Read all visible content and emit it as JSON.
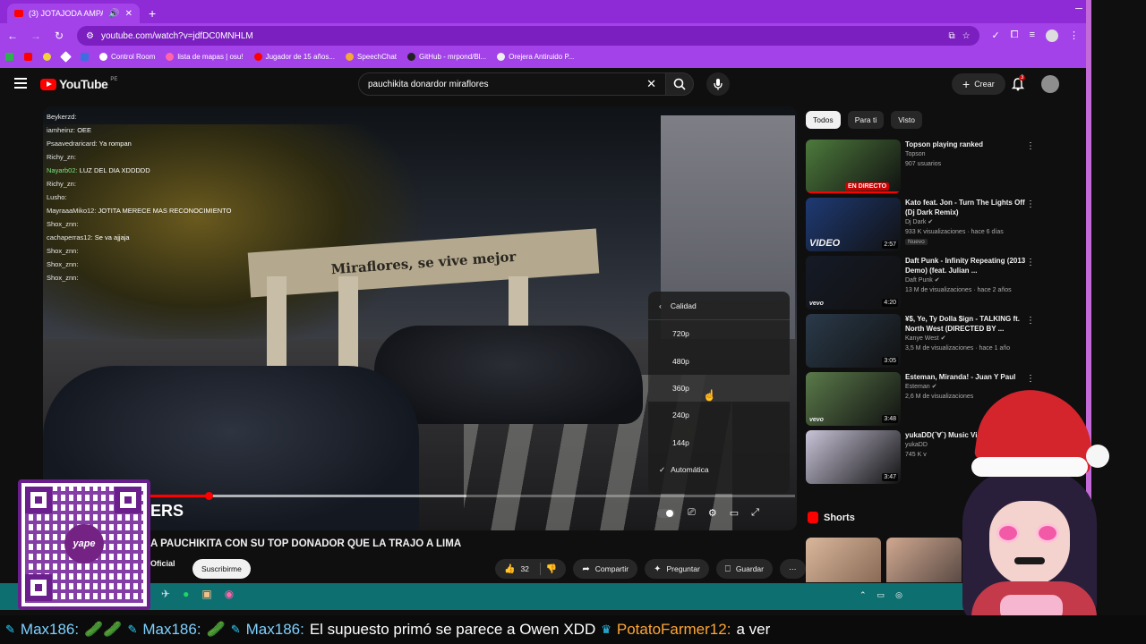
{
  "browser": {
    "tab_title": "(3) JOTAJODA AMPAYA A P...",
    "url": "youtube.com/watch?v=jdfDC0MNHLM",
    "bookmarks": [
      {
        "label": "Control Room",
        "color": "#ffffff"
      },
      {
        "label": "lista de mapas | osu!",
        "color": "#ff66aa"
      },
      {
        "label": "Jugador de 15 años...",
        "color": "#ff0000"
      },
      {
        "label": "SpeechChat",
        "color": "#f4a83a"
      },
      {
        "label": "GitHub - mrpond/Bl...",
        "color": "#222222"
      },
      {
        "label": "Orejera Antiruido P...",
        "color": "#eeeeee"
      }
    ]
  },
  "youtube": {
    "logo": "YouTube",
    "country": "PE",
    "search_value": "pauchikita donardor miraflores",
    "create_label": "Crear",
    "notif_count": "3"
  },
  "player": {
    "chat": [
      {
        "user": "",
        "msg": ""
      },
      {
        "user": "",
        "msg": ""
      },
      {
        "user": "",
        "msg": ""
      },
      {
        "user": "Beykerzd:",
        "msg": ""
      },
      {
        "user": "iamheinz:",
        "msg": "OEE"
      },
      {
        "user": "Psaavedraricard:",
        "msg": "Ya rompan"
      },
      {
        "user": "Richy_zn:",
        "msg": ""
      },
      {
        "user": "Nayarb02:",
        "msg": "LUZ DEL DIA XDDDDD",
        "green": true
      },
      {
        "user": "Richy_zn:",
        "msg": ""
      },
      {
        "user": "Lusho:",
        "msg": ""
      },
      {
        "user": "MayraaaMiko12:",
        "msg": "JOTITA MERECE MAS RECONOCIMIENTO"
      },
      {
        "user": "Shox_znn:",
        "msg": ""
      },
      {
        "user": "cachaperras12:",
        "msg": "Se va ajjaja"
      },
      {
        "user": "Shox_znn:",
        "msg": ""
      },
      {
        "user": "Shox_znn:",
        "msg": ""
      },
      {
        "user": "Shox_znn:",
        "msg": ""
      }
    ],
    "arch_text": "Miraflores, se vive mejor",
    "overlay_brand": "ERS",
    "quality_menu": {
      "header": "Calidad",
      "options": [
        "720p",
        "480p",
        "360p",
        "240p",
        "144p"
      ],
      "selected": "Automática",
      "hovered": "360p"
    },
    "progress_played": 0.09,
    "progress_loaded": 0.49
  },
  "video": {
    "title": "A PAUCHIKITA CON SU TOP DONADOR QUE LA TRAJO A LIMA",
    "channel": "Oficial",
    "subscribe_label": "Suscribirme",
    "likes": "32",
    "share_label": "Compartir",
    "ask_label": "Preguntar",
    "save_label": "Guardar"
  },
  "sidebar": {
    "chips": [
      "Todos",
      "Para ti",
      "Visto"
    ],
    "recommendations": [
      {
        "title": "Topson playing ranked",
        "channel": "Topson",
        "meta": "907 usuarios",
        "badge": "EN DIRECTO",
        "duration": "",
        "thumb": "#4d7a3c",
        "verified": false
      },
      {
        "title": "Kato feat. Jon - Turn The Lights Off (Dj Dark Remix)",
        "channel": "Dj Dark",
        "meta": "933 K visualizaciones · hace 6 días",
        "badge": "",
        "duration": "2:57",
        "thumb": "#1e3a74",
        "new": "Nuevo",
        "verified": true,
        "watermark": "VIDEO"
      },
      {
        "title": "Daft Punk - Infinity Repeating (2013 Demo) (feat. Julian ...",
        "channel": "Daft Punk",
        "meta": "13 M de visualizaciones · hace 2 años",
        "badge": "",
        "duration": "4:20",
        "thumb": "#151a26",
        "verified": true,
        "watermark": "vevo"
      },
      {
        "title": "¥$, Ye, Ty Dolla $ign - TALKING ft. North West  (DIRECTED BY ...",
        "channel": "Kanye West",
        "meta": "3,5 M de visualizaciones · hace 1 año",
        "badge": "",
        "duration": "3:05",
        "thumb": "#2a3a4a",
        "verified": true
      },
      {
        "title": "Esteman, Miranda! - Juan Y Paul",
        "channel": "Esteman",
        "meta": "2,6 M de visualizaciones",
        "badge": "",
        "duration": "3:48",
        "thumb": "#5a7a4a",
        "verified": true,
        "watermark": "vevo"
      },
      {
        "title": "yukaDD(´∀`) Music Video",
        "channel": "yukaDD",
        "meta": "745 K v",
        "badge": "",
        "duration": "3:47",
        "thumb": "#c9c4d8",
        "verified": false
      }
    ],
    "shorts_label": "Shorts"
  },
  "ticker": [
    {
      "name": "Max186:",
      "msg": "",
      "emotes": "🥒🥒"
    },
    {
      "name": "Max186:",
      "msg": "",
      "emotes": "🥒"
    },
    {
      "name": "Max186:",
      "msg": "El supuesto primó se parece a Owen XDD"
    },
    {
      "name": "PotatoFarmer12:",
      "msg": "a ver",
      "gold": true
    }
  ],
  "colors": {
    "browser_frame": "#a242e8",
    "tabbar": "#8e2bd6",
    "accent_red": "#ff0000",
    "taskbar": "#0e6f70"
  }
}
